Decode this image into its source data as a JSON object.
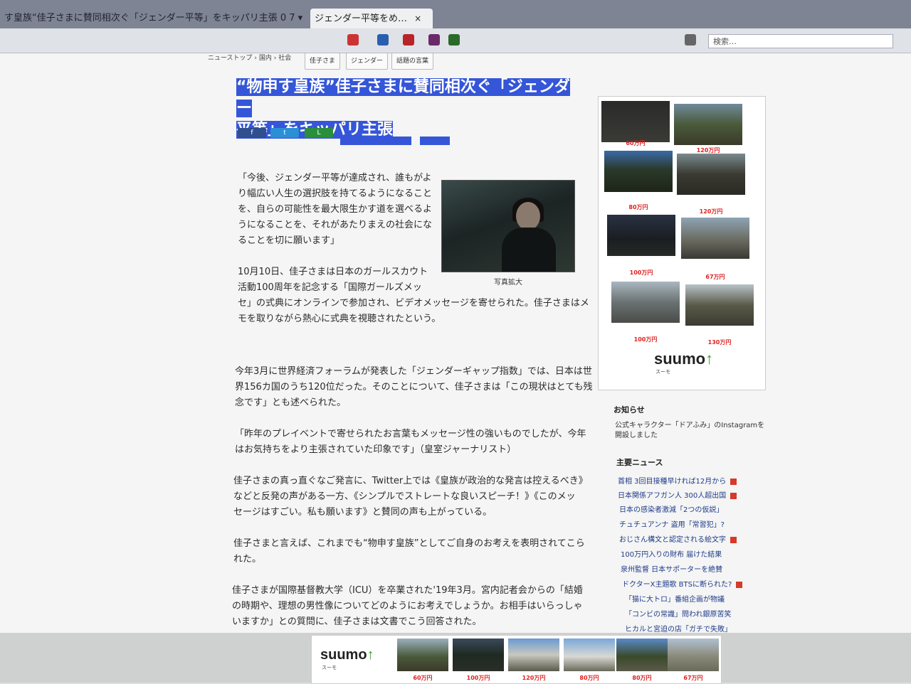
{
  "browser": {
    "tabs": [
      {
        "label": "す皇族“佳子さまに賛同相次ぐ「ジェンダー平等」をキッパリ主張 0 7 ▾"
      },
      {
        "label": "ジェンダー平等をめ…"
      }
    ],
    "close_glyph": "×",
    "address": "検索…"
  },
  "breadcrumb": "ニューストップ › 国内 › 社会",
  "tags": [
    "佳子さま",
    "ジェンダー",
    "話題の言葉"
  ],
  "article": {
    "title_line1": "“物申す皇族”佳子さまに賛同相次ぐ「ジェンダー",
    "title_line2": "平等」をキッパリ主張",
    "share": [
      "f",
      "t",
      "L"
    ],
    "photo_caption": "写真拡大",
    "paragraphs": [
      "「今後、ジェンダー平等が達成され、誰もがよ",
      "り幅広い人生の選択肢を持てるようになること",
      "を、自らの可能性を最大限生かす道を選べるよ",
      "うになることを、それがあたりまえの社会にな",
      "ることを切に願います」",
      "10月10日、佳子さまは日本のガールスカウト",
      "活動100周年を記念する「国際ガールズメッ",
      "セ」の式典にオンラインで参加され、ビデオメッセージを寄せられた。佳子さまはメ",
      "モを取りながら熱心に式典を視聴されたという。",
      "今年3月に世界経済フォーラムが発表した「ジェンダーギャップ指数」では、日本は世",
      "界156カ国のうち120位だった。そのことについて、佳子さまは「この現状はとても残",
      "念です」とも述べられた。",
      "「昨年のプレイベントで寄せられたお言葉もメッセージ性の強いものでしたが、今年",
      "はお気持ちをより主張されていた印象です」（皇室ジャーナリスト）",
      "佳子さまの真っ直ぐなご発言に、Twitter上では《皇族が政治的な発言は控えるべき》",
      "などと反発の声がある一方、《シンプルでストレートな良いスピーチ！》《このメッ",
      "セージはすごい。私も願います》と賛同の声も上がっている。",
      "佳子さまと言えば、これまでも“物申す皇族”としてご自身のお考えを表明されてこら",
      "れた。",
      "佳子さまが国際基督教大学（ICU）を卒業された'19年3月。宮内記者会からの「結婚",
      "の時期や、理想の男性像についてどのようにお考えでしょうか。お相手はいらっしゃ",
      "いますか」との質問に、佳子さまは文書でこう回答された。"
    ]
  },
  "sidebar": {
    "ad_prices": [
      "60万円",
      "120万円",
      "80万円",
      "120万円",
      "100万円",
      "67万円",
      "100万円",
      "130万円"
    ],
    "suumo_logo": "suumo",
    "suumo_sub": "スーモ",
    "notice_heading": "お知らせ",
    "notice_text": "公式キャラクター「ドアふみ」のInstagramを開設しました",
    "news_heading": "主要ニュース",
    "news": [
      {
        "title": "首相 3回目接種早ければ12月から",
        "new": true
      },
      {
        "title": "日本関係アフガン人 300人超出国",
        "new": true
      },
      {
        "title": "日本の感染者激減「2つの仮説」",
        "new": false
      },
      {
        "title": "チュチュアンナ 盗用「常習犯」?",
        "new": false
      },
      {
        "title": "おじさん構文と認定される絵文字",
        "new": true
      },
      {
        "title": "100万円入りの財布 届けた結果",
        "new": false
      },
      {
        "title": "泉州監督 日本サポーターを絶賛",
        "new": false
      },
      {
        "title": "ドクターX主題歌 BTSに断られた?",
        "new": true
      },
      {
        "title": "「猫に大トロ」番組企画が物議",
        "new": false
      },
      {
        "title": "「コンビの常識」問われ銀原苦笑",
        "new": false
      },
      {
        "title": "ヒカルと宮迫の店「ガチで失敗」",
        "new": false
      }
    ]
  },
  "bottom_ad": {
    "logo": "suumo",
    "sub": "スーモ",
    "prices": [
      "60万円",
      "100万円",
      "120万円",
      "80万円",
      "80万円",
      "67万円"
    ]
  },
  "colors": {
    "selection": "#3556d8",
    "price_red": "#dd2222",
    "link_blue": "#1f3a8a"
  }
}
